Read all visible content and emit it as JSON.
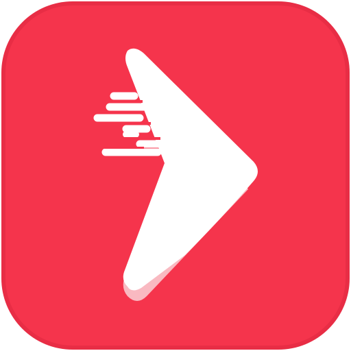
{
  "icon": {
    "name": "play-arrow-speed-icon",
    "background_color": "#F5344C",
    "rim_color": "#E82D45",
    "arrow_color": "#FFFFFF",
    "arrow_shadow_color": "#F9B9C1"
  }
}
